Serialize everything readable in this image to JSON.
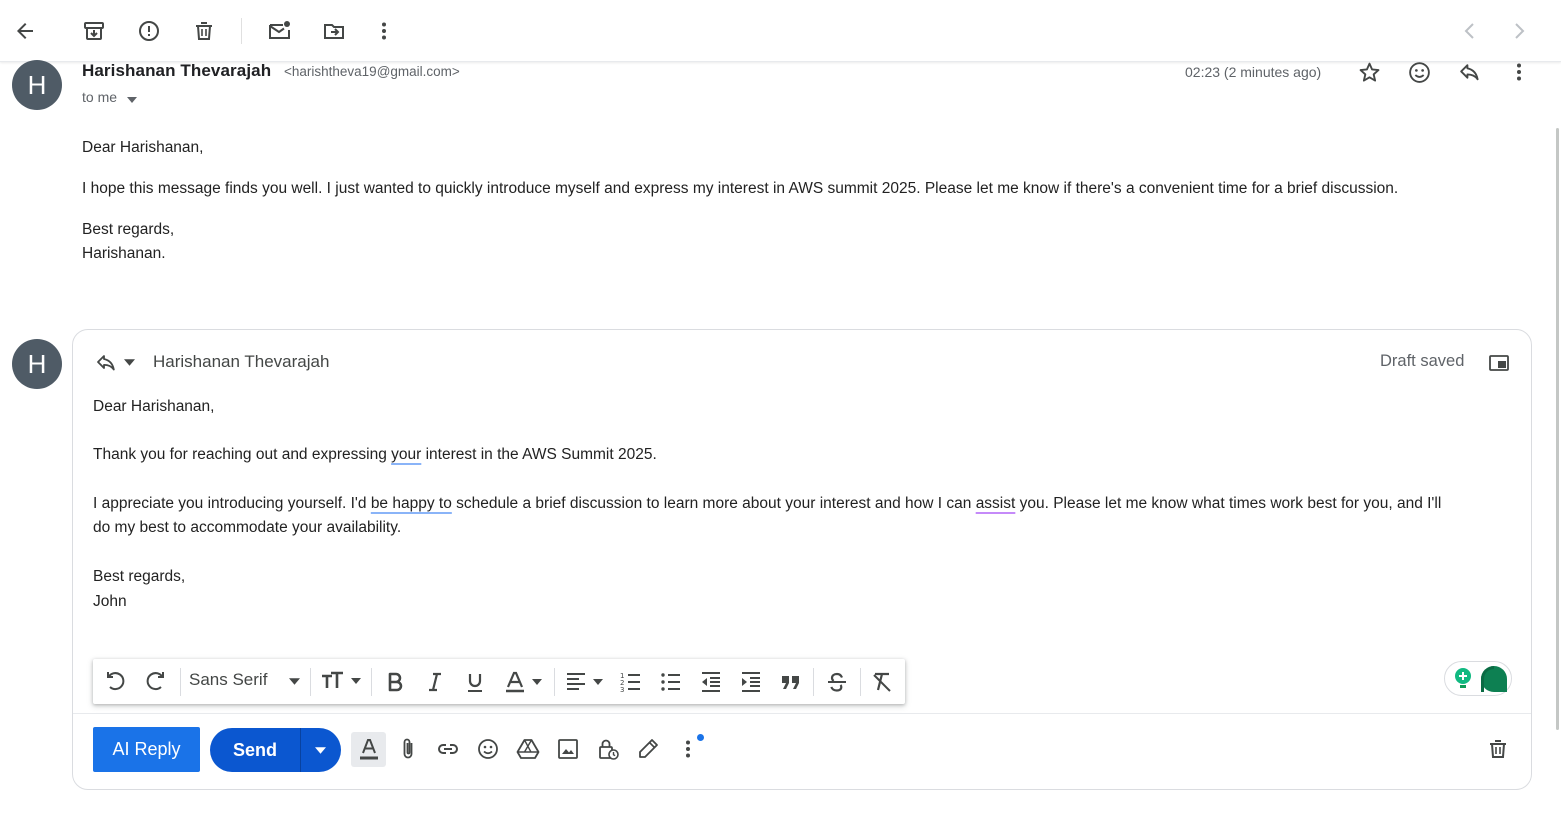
{
  "toolbar": {
    "icons": [
      "back-arrow-icon",
      "archive-icon",
      "report-spam-icon",
      "delete-icon",
      "mark-unread-icon",
      "move-to-icon",
      "more-vert-icon",
      "prev-icon",
      "next-icon"
    ]
  },
  "message": {
    "avatar_letter": "H",
    "sender_name": "Harishanan Thevarajah",
    "sender_email": "<harishtheva19@gmail.com>",
    "recipient": "to me",
    "time": "02:23 (2 minutes ago)",
    "body": {
      "greeting": "Dear Harishanan,",
      "paragraph": "I hope this message finds you well. I just wanted to quickly introduce myself and express my interest in AWS summit 2025. Please let me know if there's a convenient time for a brief discussion.",
      "closing": "Best regards,",
      "signature": "Harishanan."
    }
  },
  "reply": {
    "avatar_letter": "H",
    "to_name": "Harishanan Thevarajah",
    "status": "Draft saved",
    "body": {
      "greeting": "Dear Harishanan,",
      "p1_a": "Thank you for reaching out and expressing ",
      "p1_u": "your",
      "p1_b": " interest in the AWS Summit 2025.",
      "p2_a": "I appreciate you introducing yourself. I'd ",
      "p2_u1": "be happy to",
      "p2_b": " schedule a brief discussion to learn more about your interest and how I can ",
      "p2_u2": "assist",
      "p2_c": " you. Please let me know what times work best for you, and I'll",
      "p2_line2": "do my best to accommodate your availability.",
      "closing": "Best regards,",
      "signature": "John"
    },
    "formatting": {
      "font": "Sans Serif"
    },
    "buttons": {
      "ai_reply": "AI Reply",
      "send": "Send"
    }
  },
  "colors": {
    "primary_blue": "#1a73e8",
    "send_blue": "#0b57d0",
    "avatar": "#4f5b66",
    "extension_green": "#0f9d58"
  }
}
